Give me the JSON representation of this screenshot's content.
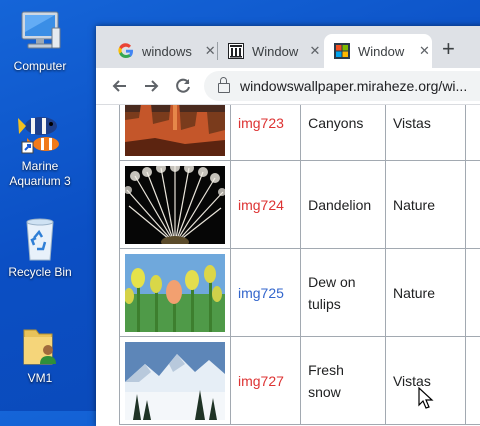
{
  "desktop": {
    "icons": [
      {
        "label": "Computer"
      },
      {
        "label": "Marine Aquarium 3"
      },
      {
        "label": "Recycle Bin"
      },
      {
        "label": "VM1"
      }
    ]
  },
  "browser": {
    "tabs": [
      {
        "title": "windows",
        "favicon": "google-g-icon",
        "active": false
      },
      {
        "title": "Window",
        "favicon": "wiki-columns-icon",
        "active": false
      },
      {
        "title": "Window",
        "favicon": "windows-logo-icon",
        "active": true
      }
    ],
    "close_symbol": "✕",
    "new_tab_symbol": "+",
    "url": "windowswallpaper.miraheze.org/wi..."
  },
  "gallery": {
    "rows": [
      {
        "id": "img723",
        "id_color": "red",
        "name": "Canyons",
        "category": "Vistas",
        "thumb": "canyons"
      },
      {
        "id": "img724",
        "id_color": "red",
        "name": "Dandelion",
        "category": "Nature",
        "thumb": "dandelion"
      },
      {
        "id": "img725",
        "id_color": "blue",
        "name": "Dew on tulips",
        "category": "Nature",
        "thumb": "tulips"
      },
      {
        "id": "img727",
        "id_color": "red",
        "name": "Fresh snow",
        "category": "Vistas",
        "thumb": "snow"
      }
    ]
  },
  "colors": {
    "desktop_bg": "#0b4fc4",
    "link_red": "#dd3333",
    "link_blue": "#3366cc"
  }
}
